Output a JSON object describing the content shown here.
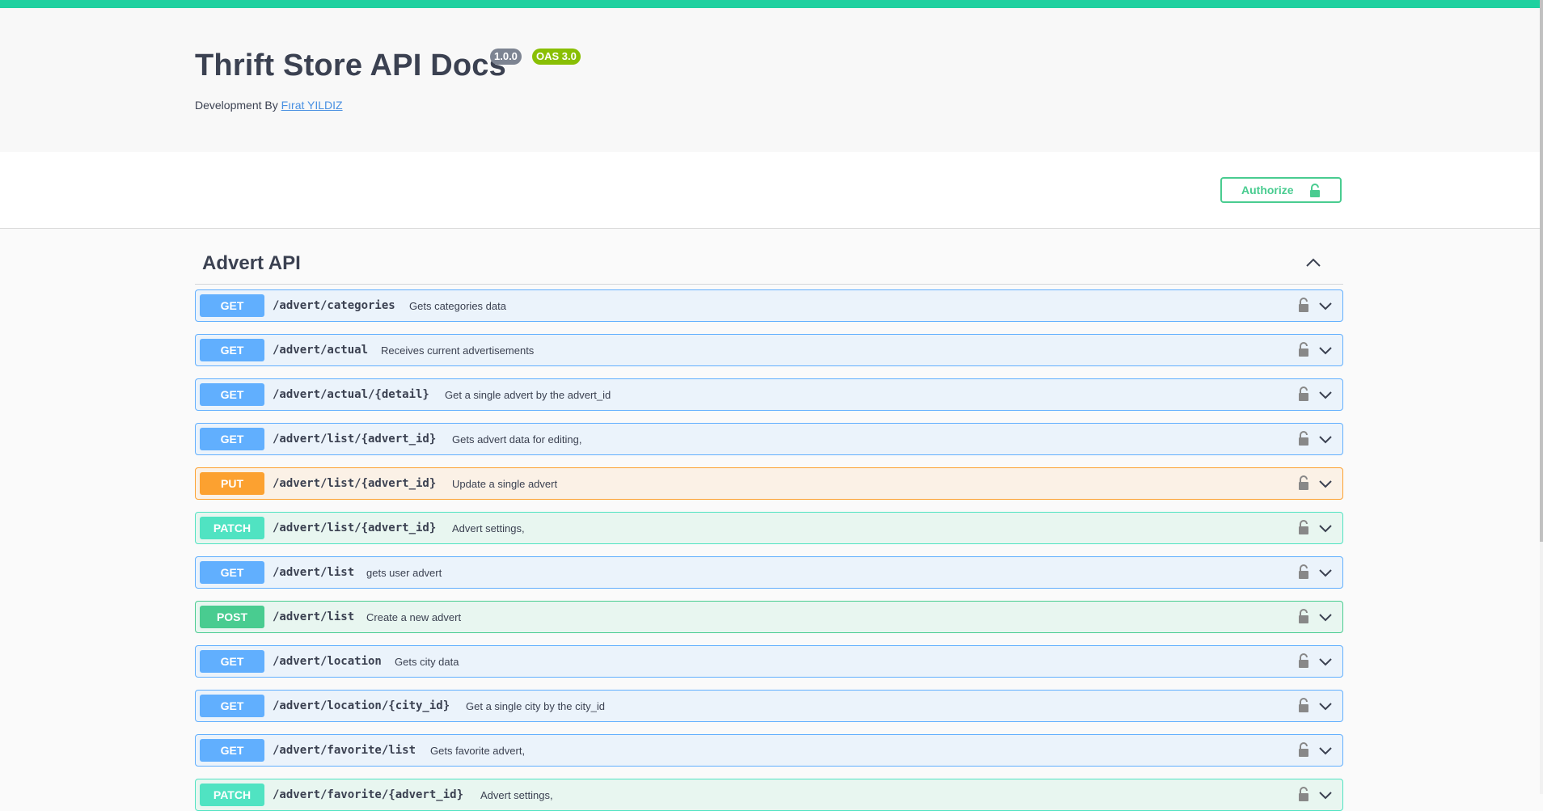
{
  "info": {
    "title": "Thrift Store API Docs",
    "version_badge": "1.0.0",
    "oas_badge": "OAS 3.0",
    "dev_prefix": "Development By",
    "dev_link": "Fırat YILDIZ"
  },
  "authorize": {
    "label": "Authorize"
  },
  "tag": {
    "title": "Advert API"
  },
  "operations": [
    {
      "method": "GET",
      "path": "/advert/categories",
      "summary": "Gets categories data"
    },
    {
      "method": "GET",
      "path": "/advert/actual",
      "summary": "Receives current advertisements"
    },
    {
      "method": "GET",
      "path": "/advert/actual/{detail}",
      "summary": "Get a single advert by the advert_id"
    },
    {
      "method": "GET",
      "path": "/advert/list/{advert_id}",
      "summary": "Gets advert data for editing,"
    },
    {
      "method": "PUT",
      "path": "/advert/list/{advert_id}",
      "summary": "Update a single advert"
    },
    {
      "method": "PATCH",
      "path": "/advert/list/{advert_id}",
      "summary": "Advert settings,"
    },
    {
      "method": "GET",
      "path": "/advert/list",
      "summary": "gets user advert"
    },
    {
      "method": "POST",
      "path": "/advert/list",
      "summary": "Create a new advert"
    },
    {
      "method": "GET",
      "path": "/advert/location",
      "summary": "Gets city data"
    },
    {
      "method": "GET",
      "path": "/advert/location/{city_id}",
      "summary": "Get a single city by the city_id"
    },
    {
      "method": "GET",
      "path": "/advert/favorite/list",
      "summary": "Gets favorite advert,"
    },
    {
      "method": "PATCH",
      "path": "/advert/favorite/{advert_id}",
      "summary": "Advert settings,"
    }
  ],
  "colors": {
    "accent_bar": "#1fd1a0",
    "get": "#61affe",
    "put": "#fca130",
    "patch": "#50e3c2",
    "post": "#49cc90"
  },
  "icons": {
    "authorize": "unlocked-padlock-icon",
    "operation_lock": "unlocked-padlock-icon",
    "expand": "chevron-down-icon",
    "collapse": "chevron-up-icon"
  }
}
